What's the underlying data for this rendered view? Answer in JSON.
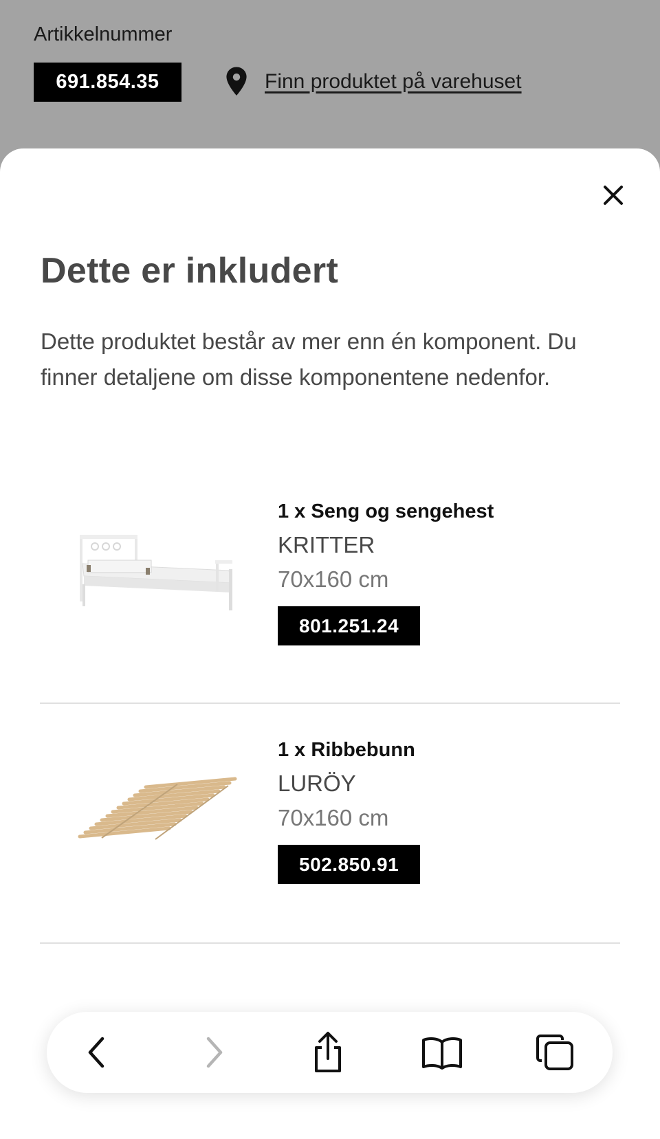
{
  "background": {
    "article_label": "Artikkelnummer",
    "article_number": "691.854.35",
    "find_in_store_link": "Finn produktet på varehuset"
  },
  "sheet": {
    "title": "Dette er inkludert",
    "description": "Dette produktet består av mer enn én komponent. Du finner detaljene om disse komponentene nedenfor.",
    "components": [
      {
        "type": "1 x Seng og sengehest",
        "name": "KRITTER",
        "size": "70x160 cm",
        "article_number": "801.251.24",
        "image": "white-child-bed-with-guardrail"
      },
      {
        "type": "1 x Ribbebunn",
        "name": "LURÖY",
        "size": "70x160 cm",
        "article_number": "502.850.91",
        "image": "wooden-slatted-bed-base"
      }
    ]
  },
  "browser_toolbar": {
    "buttons": [
      {
        "icon": "back-icon",
        "enabled": true
      },
      {
        "icon": "forward-icon",
        "enabled": false
      },
      {
        "icon": "share-icon",
        "enabled": true
      },
      {
        "icon": "bookmarks-icon",
        "enabled": true
      },
      {
        "icon": "tabs-icon",
        "enabled": true
      }
    ]
  },
  "colors": {
    "overlay_background": "#a3a3a3",
    "sheet_background": "#ffffff",
    "article_badge": "#000000",
    "title_text": "#484848",
    "secondary_text": "#777777"
  }
}
